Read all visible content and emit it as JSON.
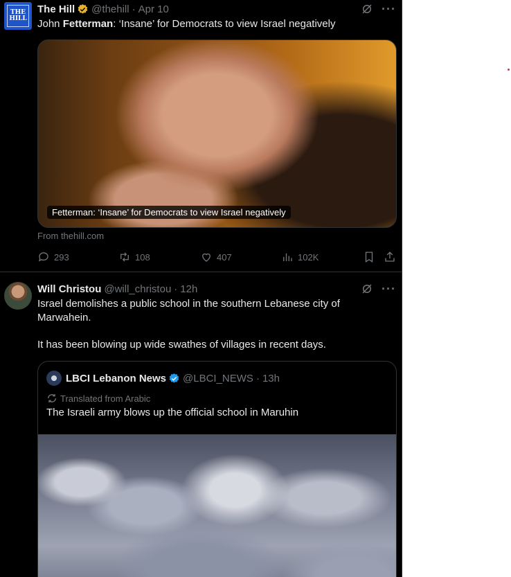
{
  "tweet1": {
    "name": "The Hill",
    "handle": "@thehill",
    "separator": "·",
    "time": "Apr 10",
    "avatar_text": "THE HILL",
    "text_pre": "John ",
    "text_bold": "Fetterman",
    "text_post": ": ‘Insane’ for Democrats to view Israel negatively",
    "card_caption": "Fetterman: ‘Insane’ for Democrats to view Israel negatively",
    "card_source": "From thehill.com",
    "replies": "293",
    "retweets": "108",
    "likes": "407",
    "views": "102K"
  },
  "tweet2": {
    "name": "Will Christou",
    "handle": "@will_christou",
    "separator": "·",
    "time": "12h",
    "text1": "Israel demolishes a public school in the southern Lebanese city of Marwahein.",
    "text2": "It has been blowing up wide swathes of villages in recent days.",
    "quote": {
      "name": "LBCI Lebanon News",
      "handle": "@LBCI_NEWS",
      "separator": "·",
      "time": "13h",
      "translated_label": "Translated from Arabic",
      "text": "The Israeli army blows up the official school in Maruhin"
    }
  },
  "colors": {
    "background": "#000000",
    "text": "#e7e9ea",
    "muted": "#71767b",
    "border": "#2f3336",
    "verified_gold": "#e8b326",
    "verified_blue": "#1d9bf0"
  },
  "icons": [
    "grok-icon",
    "more-icon",
    "reply-icon",
    "retweet-icon",
    "like-icon",
    "views-icon",
    "bookmark-icon",
    "share-icon",
    "translate-icon",
    "verified-icon"
  ]
}
